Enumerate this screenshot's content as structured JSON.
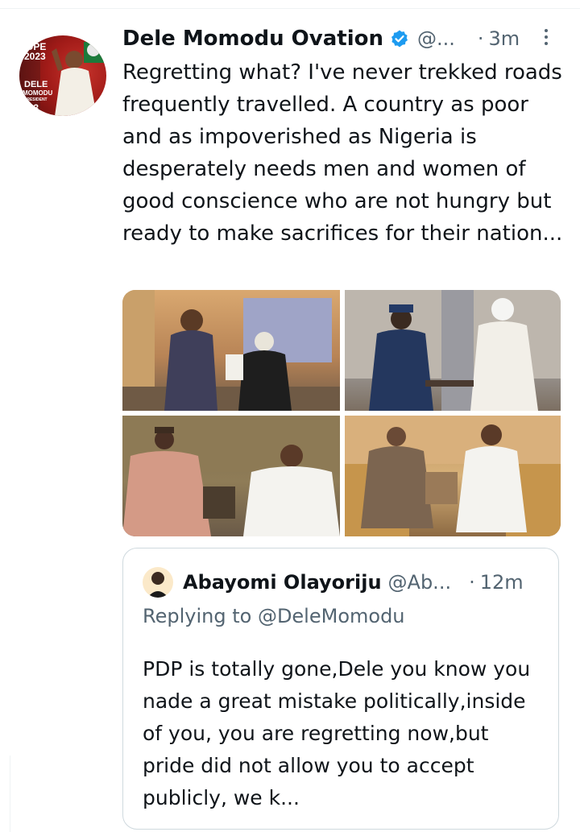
{
  "tweet": {
    "author_name": "Dele Momodu Ovation",
    "author_handle": "@...",
    "dot": "·",
    "time": "3m",
    "text": "Regretting what? I've never trekked roads frequently travelled. A country as poor and as impoverished as Nigeria is desperately needs men and women of good conscience who are not hungry but ready to make sacrifices for their nation...",
    "avatar_poster": {
      "line1": "OPE",
      "line2": "2023",
      "line3": "DELE",
      "line4": "MOMODU",
      "line5": "PRESIDENT",
      "line6": "023"
    },
    "media": [
      {
        "alt": "photo-1"
      },
      {
        "alt": "photo-2"
      },
      {
        "alt": "photo-3"
      },
      {
        "alt": "photo-4"
      }
    ]
  },
  "quote": {
    "author_name": "Abayomi Olayoriju",
    "author_handle": "@Ab...",
    "dot": "·",
    "time": "12m",
    "replying_prefix": "Replying to ",
    "replying_to": "@DeleMomodu",
    "text": "PDP is totally gone,Dele you know you nade a great mistake politically,inside of you, you are regretting now,but pride did not allow you to accept publicly, we k..."
  },
  "colors": {
    "text_primary": "#0f1419",
    "text_secondary": "#536471",
    "verified_blue": "#1d9bf0",
    "border": "#cfd9de"
  },
  "icons": {
    "verified": "verified-badge-icon",
    "more": "more-options-icon"
  }
}
